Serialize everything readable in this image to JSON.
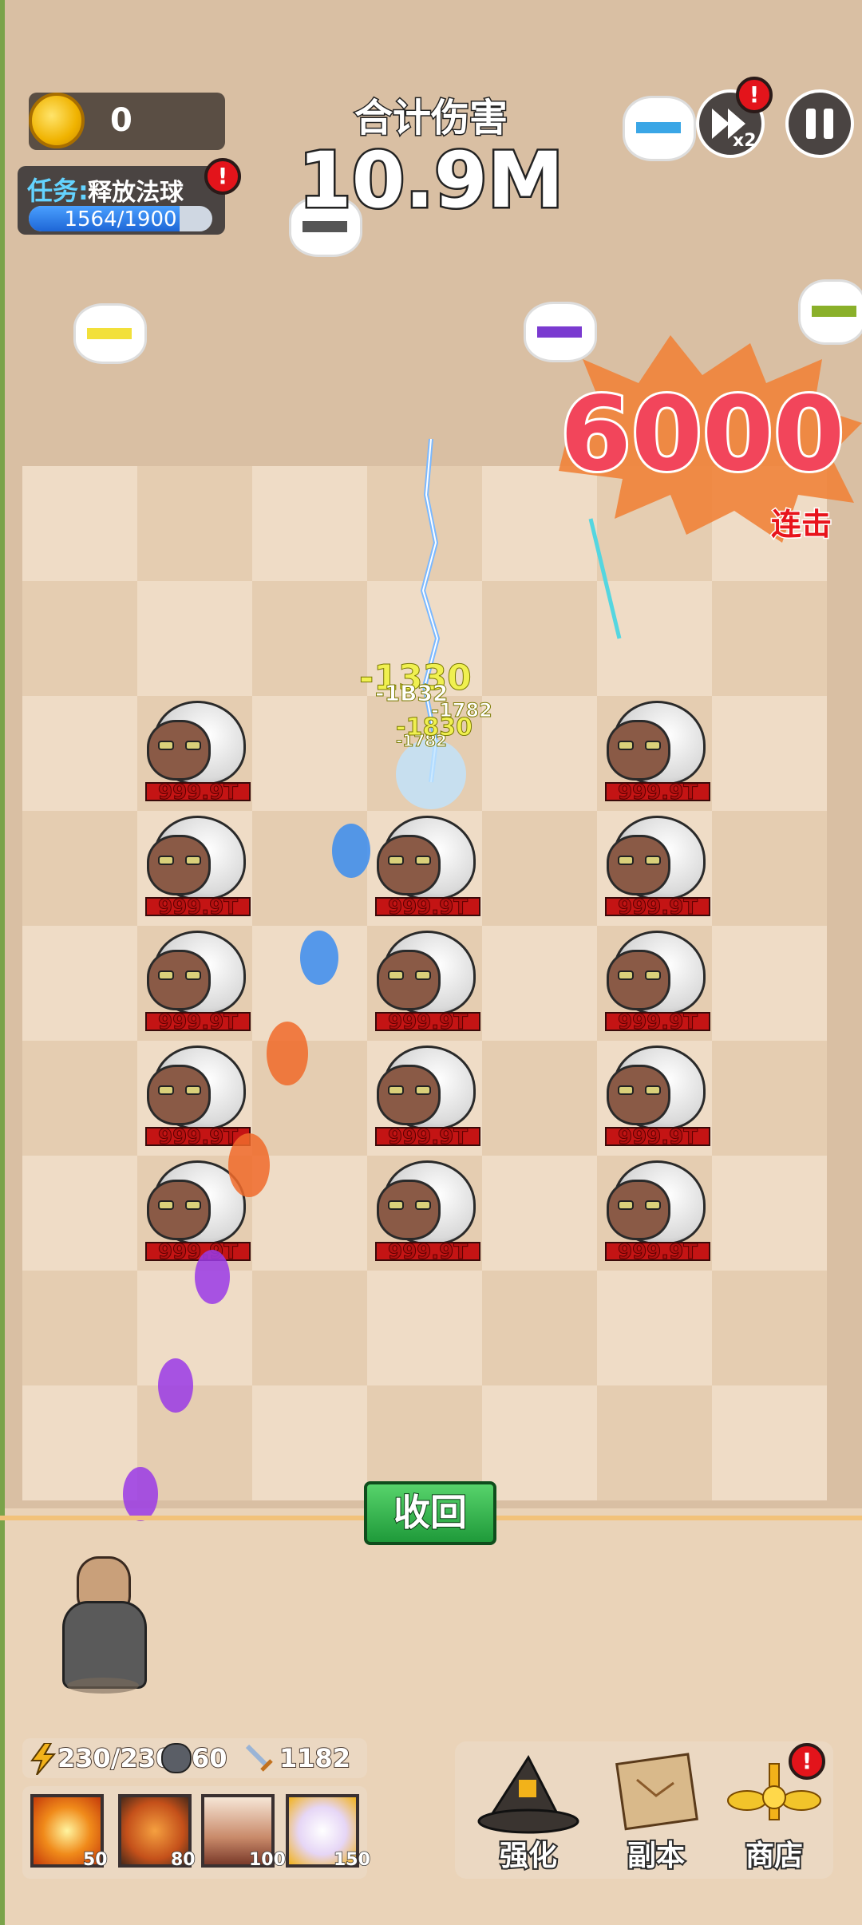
{
  "hud": {
    "coins": "0",
    "quest_label": "任务:",
    "quest_text": "释放法球",
    "quest_progress": "1564/1900",
    "quest_fraction": 0.823,
    "quest_alert": "!",
    "damage_title": "合计伤害",
    "damage_value": "10.9M",
    "speed_label": "x2",
    "speed_alert": "!"
  },
  "combo": {
    "count": "6000",
    "label": "连击"
  },
  "floating_damage": [
    "-1330",
    "-1B32",
    "-1782",
    "-1782",
    "-1830"
  ],
  "enemies": {
    "hp_label": "999.9T",
    "cells": [
      [
        0,
        1
      ],
      [
        0,
        3
      ],
      [
        1,
        1
      ],
      [
        1,
        2
      ],
      [
        1,
        3
      ],
      [
        2,
        1
      ],
      [
        2,
        2
      ],
      [
        2,
        3
      ],
      [
        3,
        1
      ],
      [
        3,
        2
      ],
      [
        3,
        3
      ],
      [
        4,
        1
      ],
      [
        4,
        2
      ],
      [
        4,
        3
      ]
    ]
  },
  "recall_button": "收回",
  "stats": {
    "energy": "230/230",
    "stone": "60",
    "attack": "1182"
  },
  "skills": [
    {
      "name": "explosion",
      "cost": "50"
    },
    {
      "name": "fire-beast",
      "cost": "80"
    },
    {
      "name": "spikes",
      "cost": "100"
    },
    {
      "name": "angel",
      "cost": "150"
    }
  ],
  "menu": {
    "upgrade": "强化",
    "dungeon": "副本",
    "shop": "商店",
    "shop_alert": "!"
  },
  "colors": {
    "board_light": "#efdcc6",
    "board_dark": "#e5cdb1",
    "combo_red": "#f2455b",
    "recall_green": "#2fb24a"
  }
}
